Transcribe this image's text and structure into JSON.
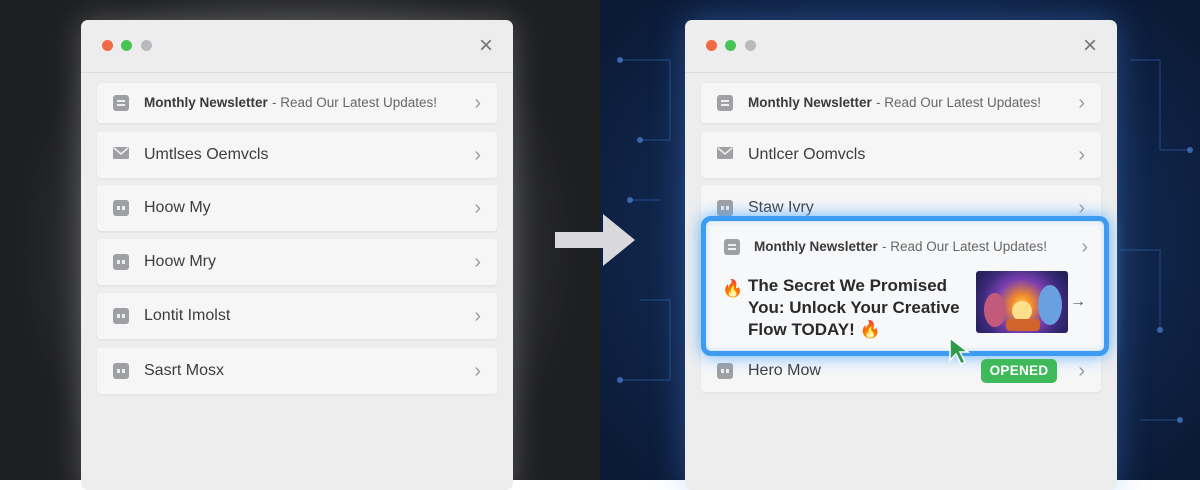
{
  "left_window": {
    "rows": [
      {
        "title": "Monthly Newsletter",
        "subtitle": "- Read Our Latest Updates!",
        "icon": "list-icon"
      },
      {
        "label": "Umtlses Oemvcls",
        "icon": "mail-icon"
      },
      {
        "label": "Hoow My",
        "icon": "message-icon"
      },
      {
        "label": "Hoow Mry",
        "icon": "message-icon"
      },
      {
        "label": "Lontit Imolst",
        "icon": "message-icon"
      },
      {
        "label": "Sasrt Mosx",
        "icon": "message-icon"
      }
    ]
  },
  "right_window": {
    "rows": [
      {
        "title": "Monthly Newsletter",
        "subtitle": "- Read Our Latest Updates!",
        "icon": "list-icon"
      },
      {
        "label": "Untlcer Oomvcls",
        "icon": "mail-icon"
      },
      {
        "label": "Staw Ivry",
        "icon": "message-icon"
      },
      {
        "label": "Hero Mow",
        "icon": "message-icon",
        "badge": "OPENED"
      }
    ],
    "highlight": {
      "title": "Monthly Newsletter",
      "subtitle": "- Read Our Latest Updates!",
      "fire": "🔥",
      "headline": "The Secret We Promised You: Unlock Your Creative Flow TODAY! 🔥",
      "link_arrow": "→"
    }
  },
  "colors": {
    "accent_highlight": "#3d9cf2",
    "badge_green": "#3fba5a",
    "cursor_green": "#2e9a4a"
  },
  "icons": {
    "close": "×",
    "chevron": "›"
  }
}
